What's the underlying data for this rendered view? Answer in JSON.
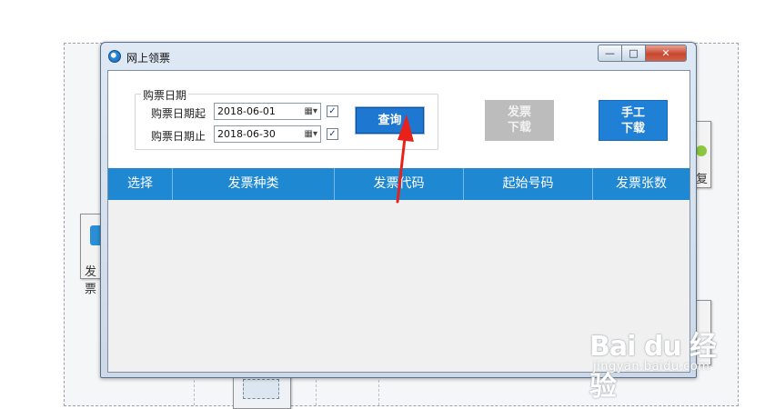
{
  "window": {
    "title": "网上领票",
    "controls": {
      "minimize": "—",
      "maximize": "□",
      "close": "✕"
    }
  },
  "filter": {
    "group_label": "购票日期",
    "start_label": "购票日期起",
    "start_value": "2018-06-01",
    "start_checked": true,
    "end_label": "购票日期止",
    "end_value": "2018-06-30",
    "end_checked": true,
    "calendar_icon": "calendar-dropdown-icon",
    "check_mark": "✓"
  },
  "buttons": {
    "query": "查询",
    "invoice_download": [
      "发票",
      "下载"
    ],
    "invoice_download_enabled": false,
    "manual_download": [
      "手工",
      "下载"
    ]
  },
  "table": {
    "columns": [
      "选择",
      "发票种类",
      "发票代码",
      "起始号码",
      "发票张数"
    ],
    "rows": []
  },
  "background": {
    "left_tile_text": "发票",
    "right_tile_text": "复"
  },
  "watermark": {
    "brand": "Bai du 经验",
    "url": "jingyan.baidu.com"
  },
  "colors": {
    "header_blue": "#1f88d3",
    "button_blue": "#1e77d0",
    "disabled_gray": "#bcbcbc",
    "annotation_red": "#e8211b"
  }
}
